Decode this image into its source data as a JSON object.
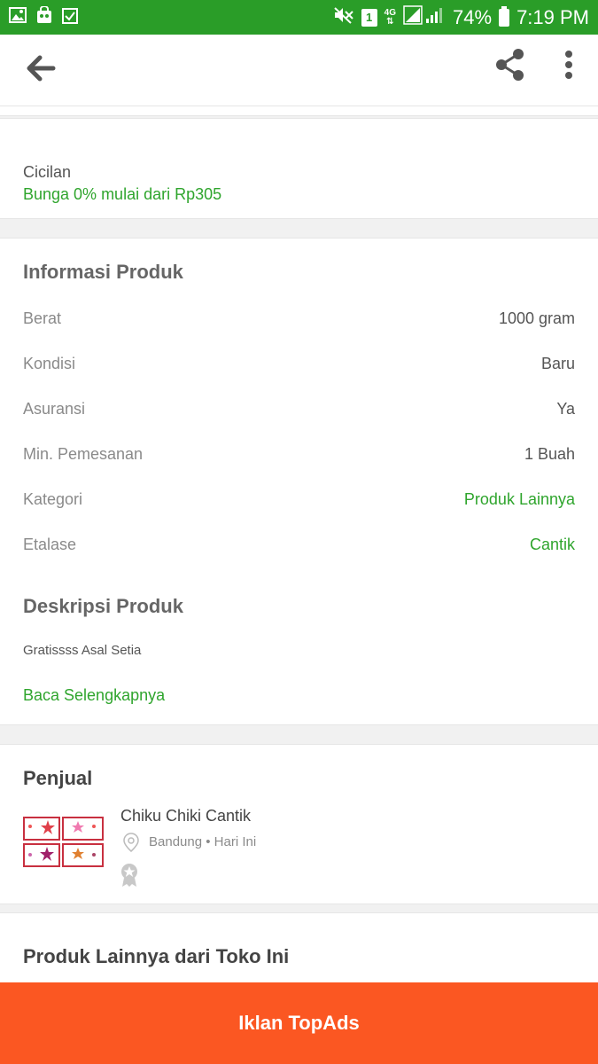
{
  "status_bar": {
    "battery": "74%",
    "time": "7:19 PM",
    "sim_slot": "1",
    "network": "4G",
    "icons": [
      "image-icon",
      "shopping-bag-icon",
      "checkbox-icon",
      "mute-icon",
      "sim-icon",
      "signal-icon",
      "battery-icon"
    ]
  },
  "app_bar": {
    "icons": [
      "back-arrow-icon",
      "share-icon",
      "more-vert-icon"
    ]
  },
  "cicilan": {
    "label": "Cicilan",
    "value": "Bunga 0% mulai dari Rp305"
  },
  "product_info": {
    "title": "Informasi Produk",
    "rows": [
      {
        "key": "Berat",
        "value": "1000 gram"
      },
      {
        "key": "Kondisi",
        "value": "Baru"
      },
      {
        "key": "Asuransi",
        "value": "Ya"
      },
      {
        "key": "Min. Pemesanan",
        "value": "1 Buah"
      },
      {
        "key": "Kategori",
        "value": "Produk Lainnya"
      },
      {
        "key": "Etalase",
        "value": "Cantik"
      }
    ]
  },
  "description": {
    "title": "Deskripsi Produk",
    "text": "Gratissss Asal Setia",
    "read_more": "Baca Selengkapnya"
  },
  "seller": {
    "title": "Penjual",
    "shop_name": "Chiku Chiki Cantik",
    "location": "Bandung • Hari Ini"
  },
  "more_products": {
    "title": "Produk Lainnya dari Toko Ini"
  },
  "bottom_button": {
    "label": "Iklan TopAds"
  },
  "colors": {
    "status_bar": "#2a9d28",
    "accent_green": "#2fa52d",
    "cta_orange": "#fb5722"
  }
}
